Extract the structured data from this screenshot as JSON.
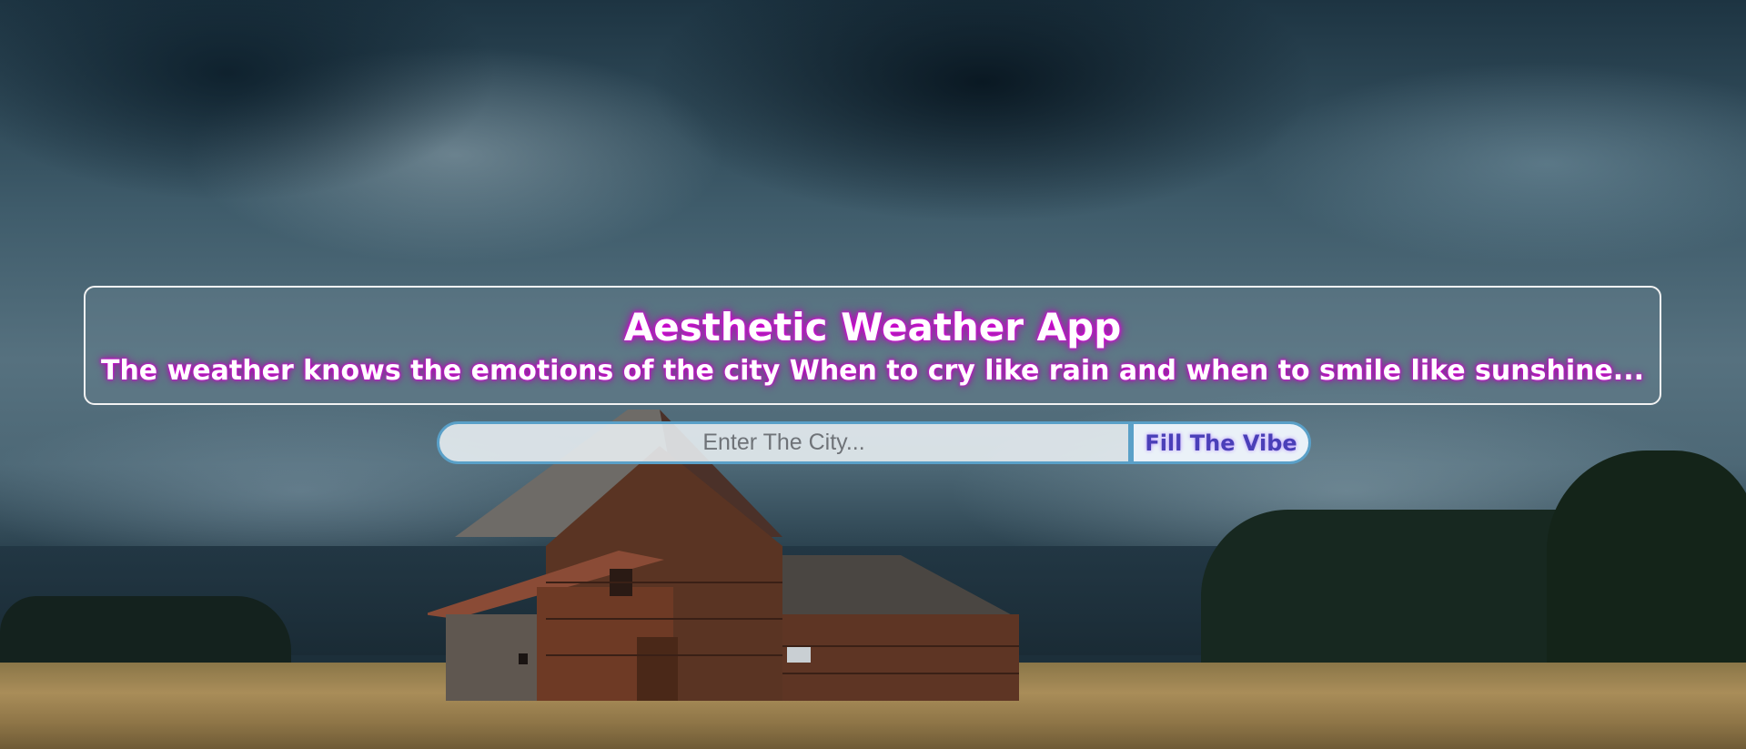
{
  "app": {
    "title": "Aesthetic Weather App",
    "tagline": "The weather knows the emotions of the city When to cry like rain and when to smile like sunshine..."
  },
  "search": {
    "placeholder": "Enter The City...",
    "value": "",
    "button_label": "Fill The Vibe"
  },
  "background": {
    "description_icon": "barn-storm-photo"
  },
  "colors": {
    "title_glow": "#ff00ff",
    "input_border": "#5aa0c8",
    "button_text": "#4a3fb8"
  }
}
